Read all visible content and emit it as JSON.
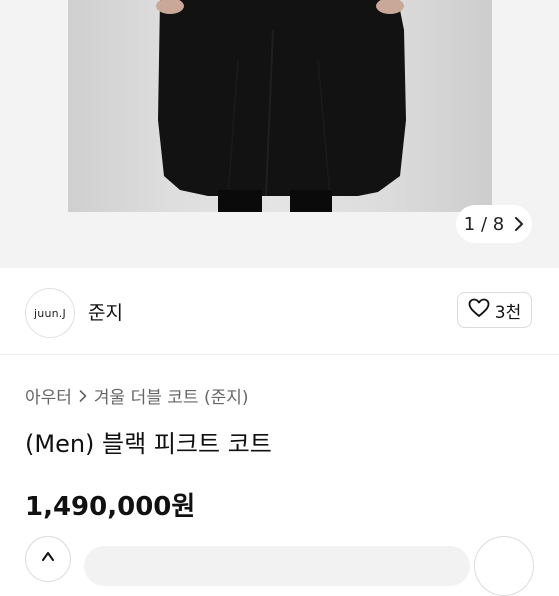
{
  "gallery": {
    "counter_current": "1",
    "counter_total": "8",
    "counter_separator": "/",
    "next_icon": "chevron-right-icon"
  },
  "seller": {
    "avatar_text": "juun.J",
    "name": "준지",
    "like_icon": "heart-outline-icon",
    "like_count": "3천"
  },
  "breadcrumb": {
    "category": "아우터",
    "subcategory": "겨울 더블 코트 (준지)",
    "separator_icon": "chevron-right-icon"
  },
  "product": {
    "title": "(Men) 블랙 피크트 코트",
    "price": "1,490,000원"
  },
  "colors": {
    "hero_bg": "#f3f3f3",
    "coat": "#101010",
    "text_primary": "#111111",
    "text_secondary": "#666666"
  }
}
